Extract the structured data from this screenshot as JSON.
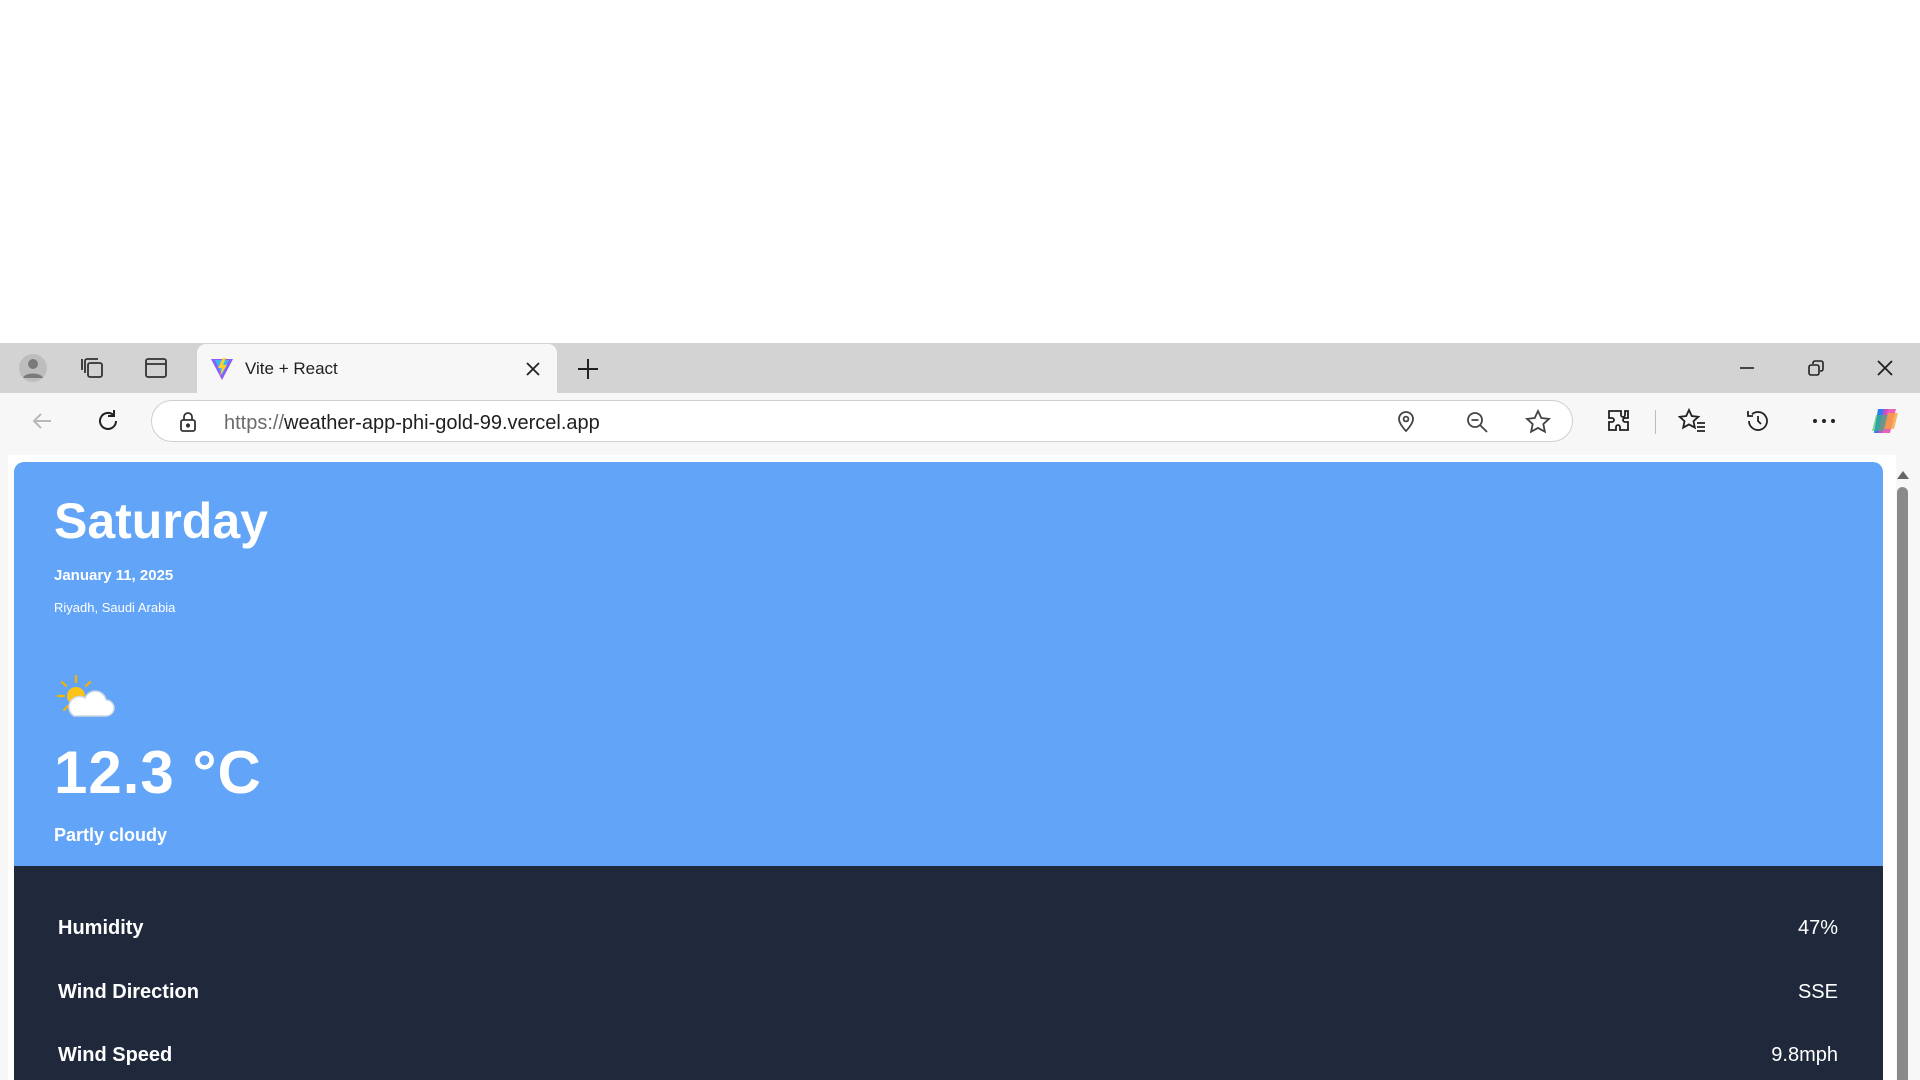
{
  "browser": {
    "tab": {
      "title": "Vite + React"
    },
    "address": {
      "scheme": "https://",
      "host": "weather-app-phi-gold-99.vercel.app"
    }
  },
  "weather": {
    "day": "Saturday",
    "date": "January 11, 2025",
    "location": "Riyadh, Saudi Arabia",
    "icon": "partly-cloudy-icon",
    "temperature": "12.3 °C",
    "condition": "Partly cloudy"
  },
  "details": [
    {
      "label": "Humidity",
      "value": "47%"
    },
    {
      "label": "Wind Direction",
      "value": "SSE"
    },
    {
      "label": "Wind Speed",
      "value": "9.8mph"
    }
  ],
  "colors": {
    "card": "#62a4f7",
    "details": "#1f293b",
    "tabstrip": "#d3d3d3"
  }
}
